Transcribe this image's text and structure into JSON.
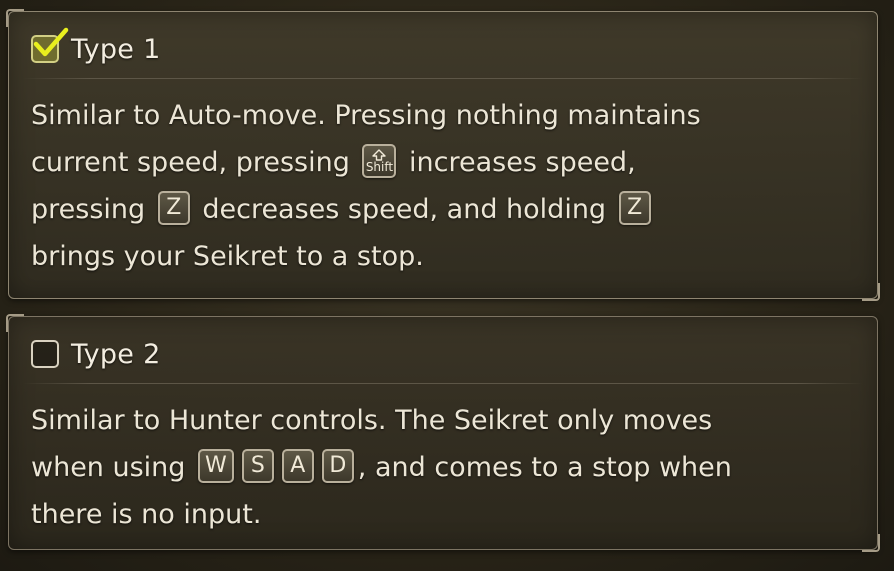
{
  "options": [
    {
      "label": "Type 1",
      "checked": true,
      "lines": [
        {
          "text": "Similar to Auto-move. Pressing nothing maintains"
        },
        {
          "before": "current speed, pressing",
          "key": "Shift",
          "after": "increases speed,"
        },
        {
          "before": "pressing",
          "key": "Z",
          "middle": "decreases speed, and holding",
          "key2": "Z"
        },
        {
          "text": "brings your Seikret to a stop."
        }
      ]
    },
    {
      "label": "Type 2",
      "checked": false,
      "lines": [
        {
          "text": "Similar to Hunter controls. The Seikret only moves"
        },
        {
          "before": "when using",
          "keys": [
            "W",
            "S",
            "A",
            "D"
          ],
          "after": ", and comes to a stop when"
        },
        {
          "text": "there is no input."
        }
      ]
    }
  ],
  "icons": {
    "checked": "checkmark-icon",
    "unchecked": "empty-checkbox-icon",
    "shift": "shift-key-icon"
  },
  "colors": {
    "checkmark": "#e8ef1e",
    "checkbox_checked_fill": "#6f6c2e",
    "text": "#ece6d6",
    "panel_border": "#7d7463"
  }
}
